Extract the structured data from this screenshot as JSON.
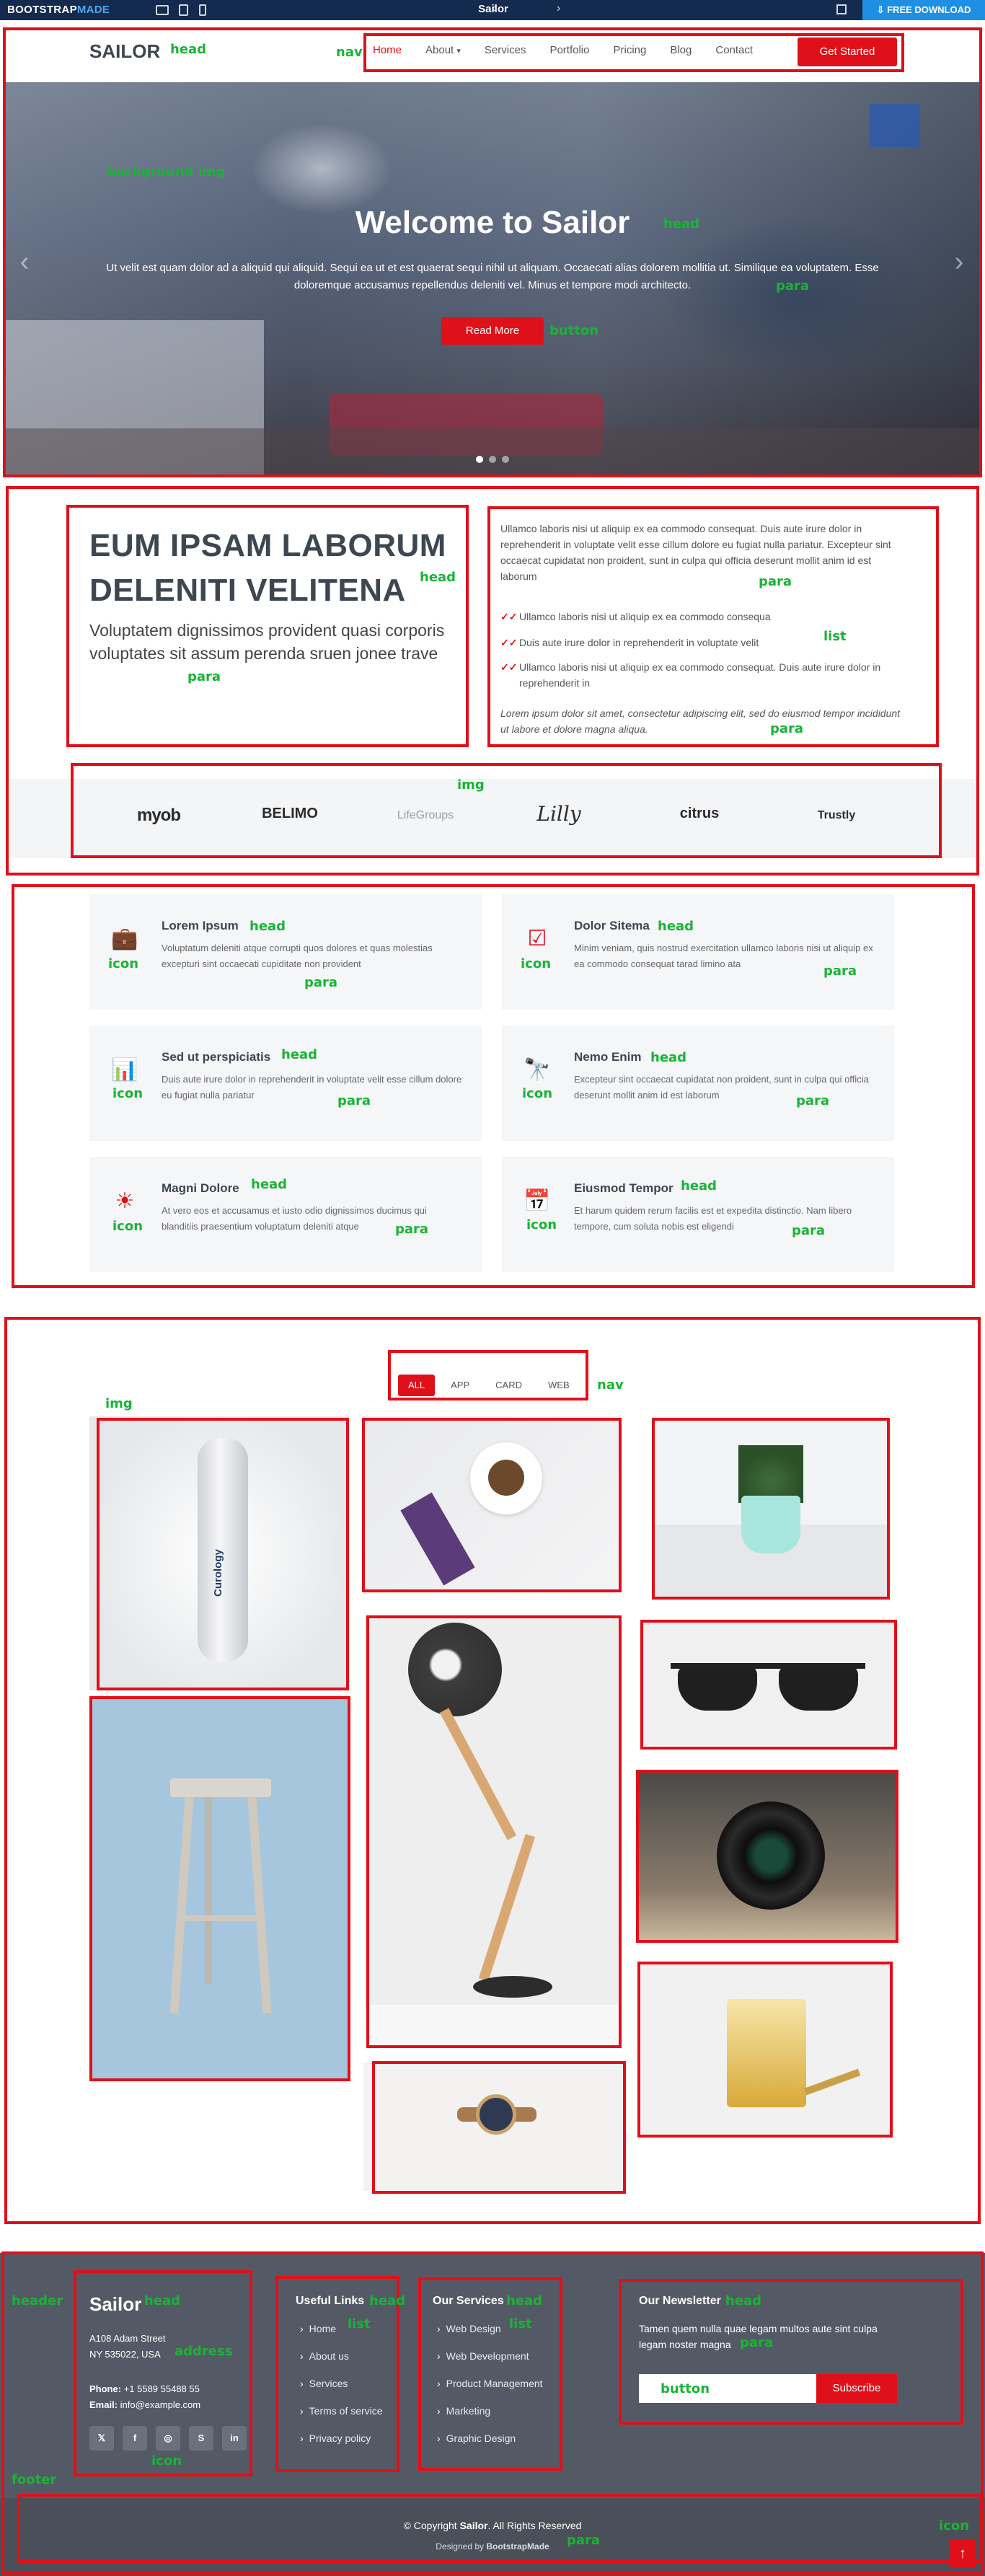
{
  "topbar": {
    "brand_a": "BOOTSTRAP",
    "brand_b": "MADE",
    "title": "Sailor",
    "download": "FREE DOWNLOAD",
    "colors": {
      "bar": "#142a4f",
      "download": "#1e8fe3"
    }
  },
  "header": {
    "logo": "SAILOR",
    "nav": [
      "Home",
      "About",
      "Services",
      "Portfolio",
      "Pricing",
      "Blog",
      "Contact"
    ],
    "about_caret": "▾",
    "cta": "Get Started"
  },
  "hero": {
    "title": "Welcome to Sailor",
    "text": "Ut velit est quam dolor ad a aliquid qui aliquid. Sequi ea ut et est quaerat sequi nihil ut aliquam. Occaecati alias dolorem mollitia ut. Similique ea voluptatem. Esse doloremque accusamus repellendus deleniti vel. Minus et tempore modi architecto.",
    "button": "Read More",
    "prev": "‹",
    "next": "›"
  },
  "about": {
    "heading": "EUM IPSAM LABORUM DELENITI VELITENA",
    "subheading": "Voluptatem dignissimos provident quasi corporis voluptates sit assum perenda sruen jonee trave",
    "paragraph": "Ullamco laboris nisi ut aliquip ex ea commodo consequat. Duis aute irure dolor in reprehenderit in voluptate velit esse cillum dolore eu fugiat nulla pariatur. Excepteur sint occaecat cupidatat non proident, sunt in culpa qui officia deserunt mollit anim id est laborum",
    "check": "✓✓",
    "list": [
      "Ullamco laboris nisi ut aliquip ex ea commodo consequa",
      "Duis aute irure dolor in reprehenderit in voluptate velit",
      "Ullamco laboris nisi ut aliquip ex ea commodo consequat. Duis aute irure dolor in reprehenderit in"
    ],
    "italic": "Lorem ipsum dolor sit amet, consectetur adipiscing elit, sed do eiusmod tempor incididunt ut labore et dolore magna aliqua."
  },
  "clients": [
    "myob",
    "BELIMO",
    "LifeGroups",
    "Lilly",
    "citrus",
    "Trustly"
  ],
  "services": [
    {
      "icon": "briefcase-icon",
      "glyph": "💼",
      "title": "Lorem Ipsum",
      "text": "Voluptatum deleniti atque corrupti quos dolores et quas molestias excepturi sint occaecati cupiditate non provident"
    },
    {
      "icon": "card-checklist-icon",
      "glyph": "☑",
      "title": "Dolor Sitema",
      "text": "Minim veniam, quis nostrud exercitation ullamco laboris nisi ut aliquip ex ea commodo consequat tarad limino ata"
    },
    {
      "icon": "bar-chart-icon",
      "glyph": "📊",
      "title": "Sed ut perspiciatis",
      "text": "Duis aute irure dolor in reprehenderit in voluptate velit esse cillum dolore eu fugiat nulla pariatur"
    },
    {
      "icon": "binoculars-icon",
      "glyph": "🔭",
      "title": "Nemo Enim",
      "text": "Excepteur sint occaecat cupidatat non proident, sunt in culpa qui officia deserunt mollit anim id est laborum"
    },
    {
      "icon": "brightness-icon",
      "glyph": "☀",
      "title": "Magni Dolore",
      "text": "At vero eos et accusamus et iusto odio dignissimos ducimus qui blanditiis praesentium voluptatum deleniti atque"
    },
    {
      "icon": "calendar-icon",
      "glyph": "📅",
      "title": "Eiusmod Tempor",
      "text": "Et harum quidem rerum facilis est et expedita distinctio. Nam libero tempore, cum soluta nobis est eligendi"
    }
  ],
  "portfolio": {
    "filters": [
      "ALL",
      "APP",
      "CARD",
      "WEB"
    ],
    "brand_text": "Curology"
  },
  "footer": {
    "logo": "Sailor",
    "address_1": "A108 Adam Street",
    "address_2": "NY 535022, USA",
    "phone_label": "Phone:",
    "phone": "+1 5589 55488 55",
    "email_label": "Email:",
    "email": "info@example.com",
    "social": [
      "𝕏",
      "f",
      "◎",
      "S",
      "in"
    ],
    "useful_title": "Useful Links",
    "useful": [
      "Home",
      "About us",
      "Services",
      "Terms of service",
      "Privacy policy"
    ],
    "services_title": "Our Services",
    "services": [
      "Web Design",
      "Web Development",
      "Product Management",
      "Marketing",
      "Graphic Design"
    ],
    "newsletter_title": "Our Newsletter",
    "newsletter_text": "Tamen quem nulla quae legam multos aute sint culpa legam noster magna",
    "subscribe": "Subscribe",
    "copyright_pre": "© Copyright",
    "copyright_brand": "Sailor",
    "copyright_post": ". All Rights Reserved",
    "designed_pre": "Designed by",
    "designed_brand": "BootstrapMade",
    "to_top": "↑"
  },
  "annotations": [
    "head",
    "nav",
    "background img",
    "head",
    "para",
    "button",
    "head",
    "para",
    "para",
    "list",
    "para",
    "img",
    "head",
    "icon",
    "para",
    "head",
    "icon",
    "para",
    "head",
    "icon",
    "para",
    "head",
    "icon",
    "para",
    "head",
    "icon",
    "para",
    "head",
    "icon",
    "para",
    "nav",
    "img",
    "header",
    "head",
    "address",
    "icon",
    "head",
    "list",
    "head",
    "list",
    "head",
    "para",
    "button",
    "footer",
    "para",
    "icon"
  ]
}
